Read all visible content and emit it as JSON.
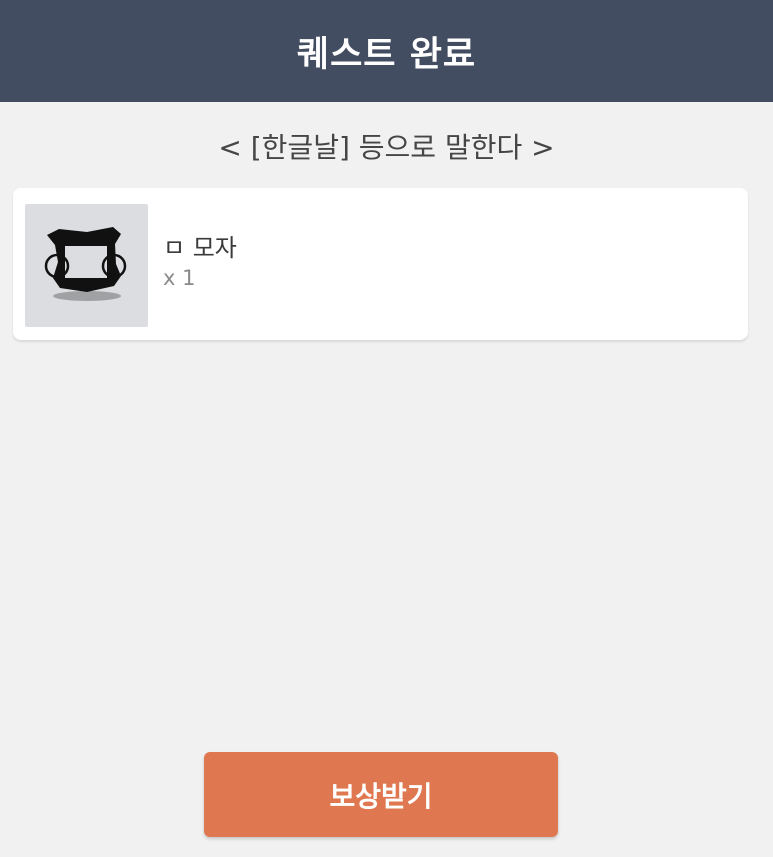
{
  "header": {
    "title": "퀘스트 완료"
  },
  "quest": {
    "name": "< [한글날] 등으로 말한다 >"
  },
  "reward": {
    "icon": "hat-icon",
    "item_name": "ㅁ 모자",
    "quantity": "x 1"
  },
  "actions": {
    "claim_label": "보상받기"
  },
  "colors": {
    "header_bg": "#434d62",
    "page_bg": "#f1f1f1",
    "button_bg": "#df7851"
  }
}
